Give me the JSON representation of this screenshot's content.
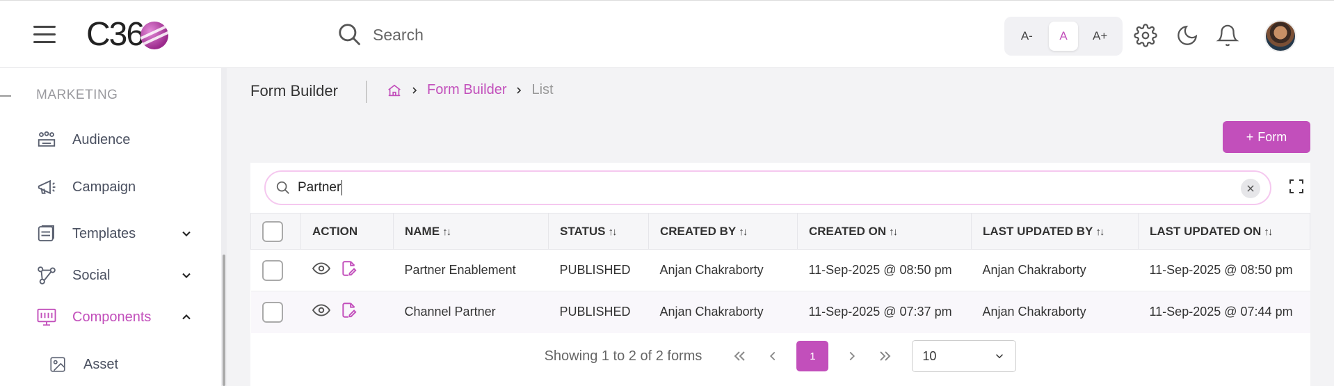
{
  "header": {
    "logo_text": "C36",
    "search_placeholder": "Search",
    "font_small": "A-",
    "font_normal": "A",
    "font_large": "A+"
  },
  "sidebar": {
    "section_label": "MARKETING",
    "items": [
      {
        "label": "Audience",
        "icon": "audience-icon"
      },
      {
        "label": "Campaign",
        "icon": "megaphone-icon"
      },
      {
        "label": "Templates",
        "icon": "templates-icon"
      },
      {
        "label": "Social",
        "icon": "share-icon"
      },
      {
        "label": "Components",
        "icon": "components-icon"
      },
      {
        "label": "Asset",
        "icon": "image-icon"
      }
    ]
  },
  "page": {
    "title": "Form Builder",
    "breadcrumb": {
      "link": "Form Builder",
      "current": "List"
    },
    "add_button": "Form"
  },
  "filter": {
    "value": "Partner"
  },
  "table": {
    "columns": [
      "ACTION",
      "NAME",
      "STATUS",
      "CREATED BY",
      "CREATED ON",
      "LAST UPDATED BY",
      "LAST UPDATED ON"
    ],
    "rows": [
      {
        "name": "Partner Enablement",
        "status": "PUBLISHED",
        "created_by": "Anjan Chakraborty",
        "created_on": "11-Sep-2025 @ 08:50 pm",
        "updated_by": "Anjan Chakraborty",
        "updated_on": "11-Sep-2025 @ 08:50 pm"
      },
      {
        "name": "Channel Partner",
        "status": "PUBLISHED",
        "created_by": "Anjan Chakraborty",
        "created_on": "11-Sep-2025 @ 07:37 pm",
        "updated_by": "Anjan Chakraborty",
        "updated_on": "11-Sep-2025 @ 07:44 pm"
      }
    ]
  },
  "pagination": {
    "info": "Showing 1 to 2 of 2 forms",
    "current_page": "1",
    "page_size": "10"
  },
  "colors": {
    "accent": "#c24fbb",
    "accent_light": "#f5c8ef"
  }
}
